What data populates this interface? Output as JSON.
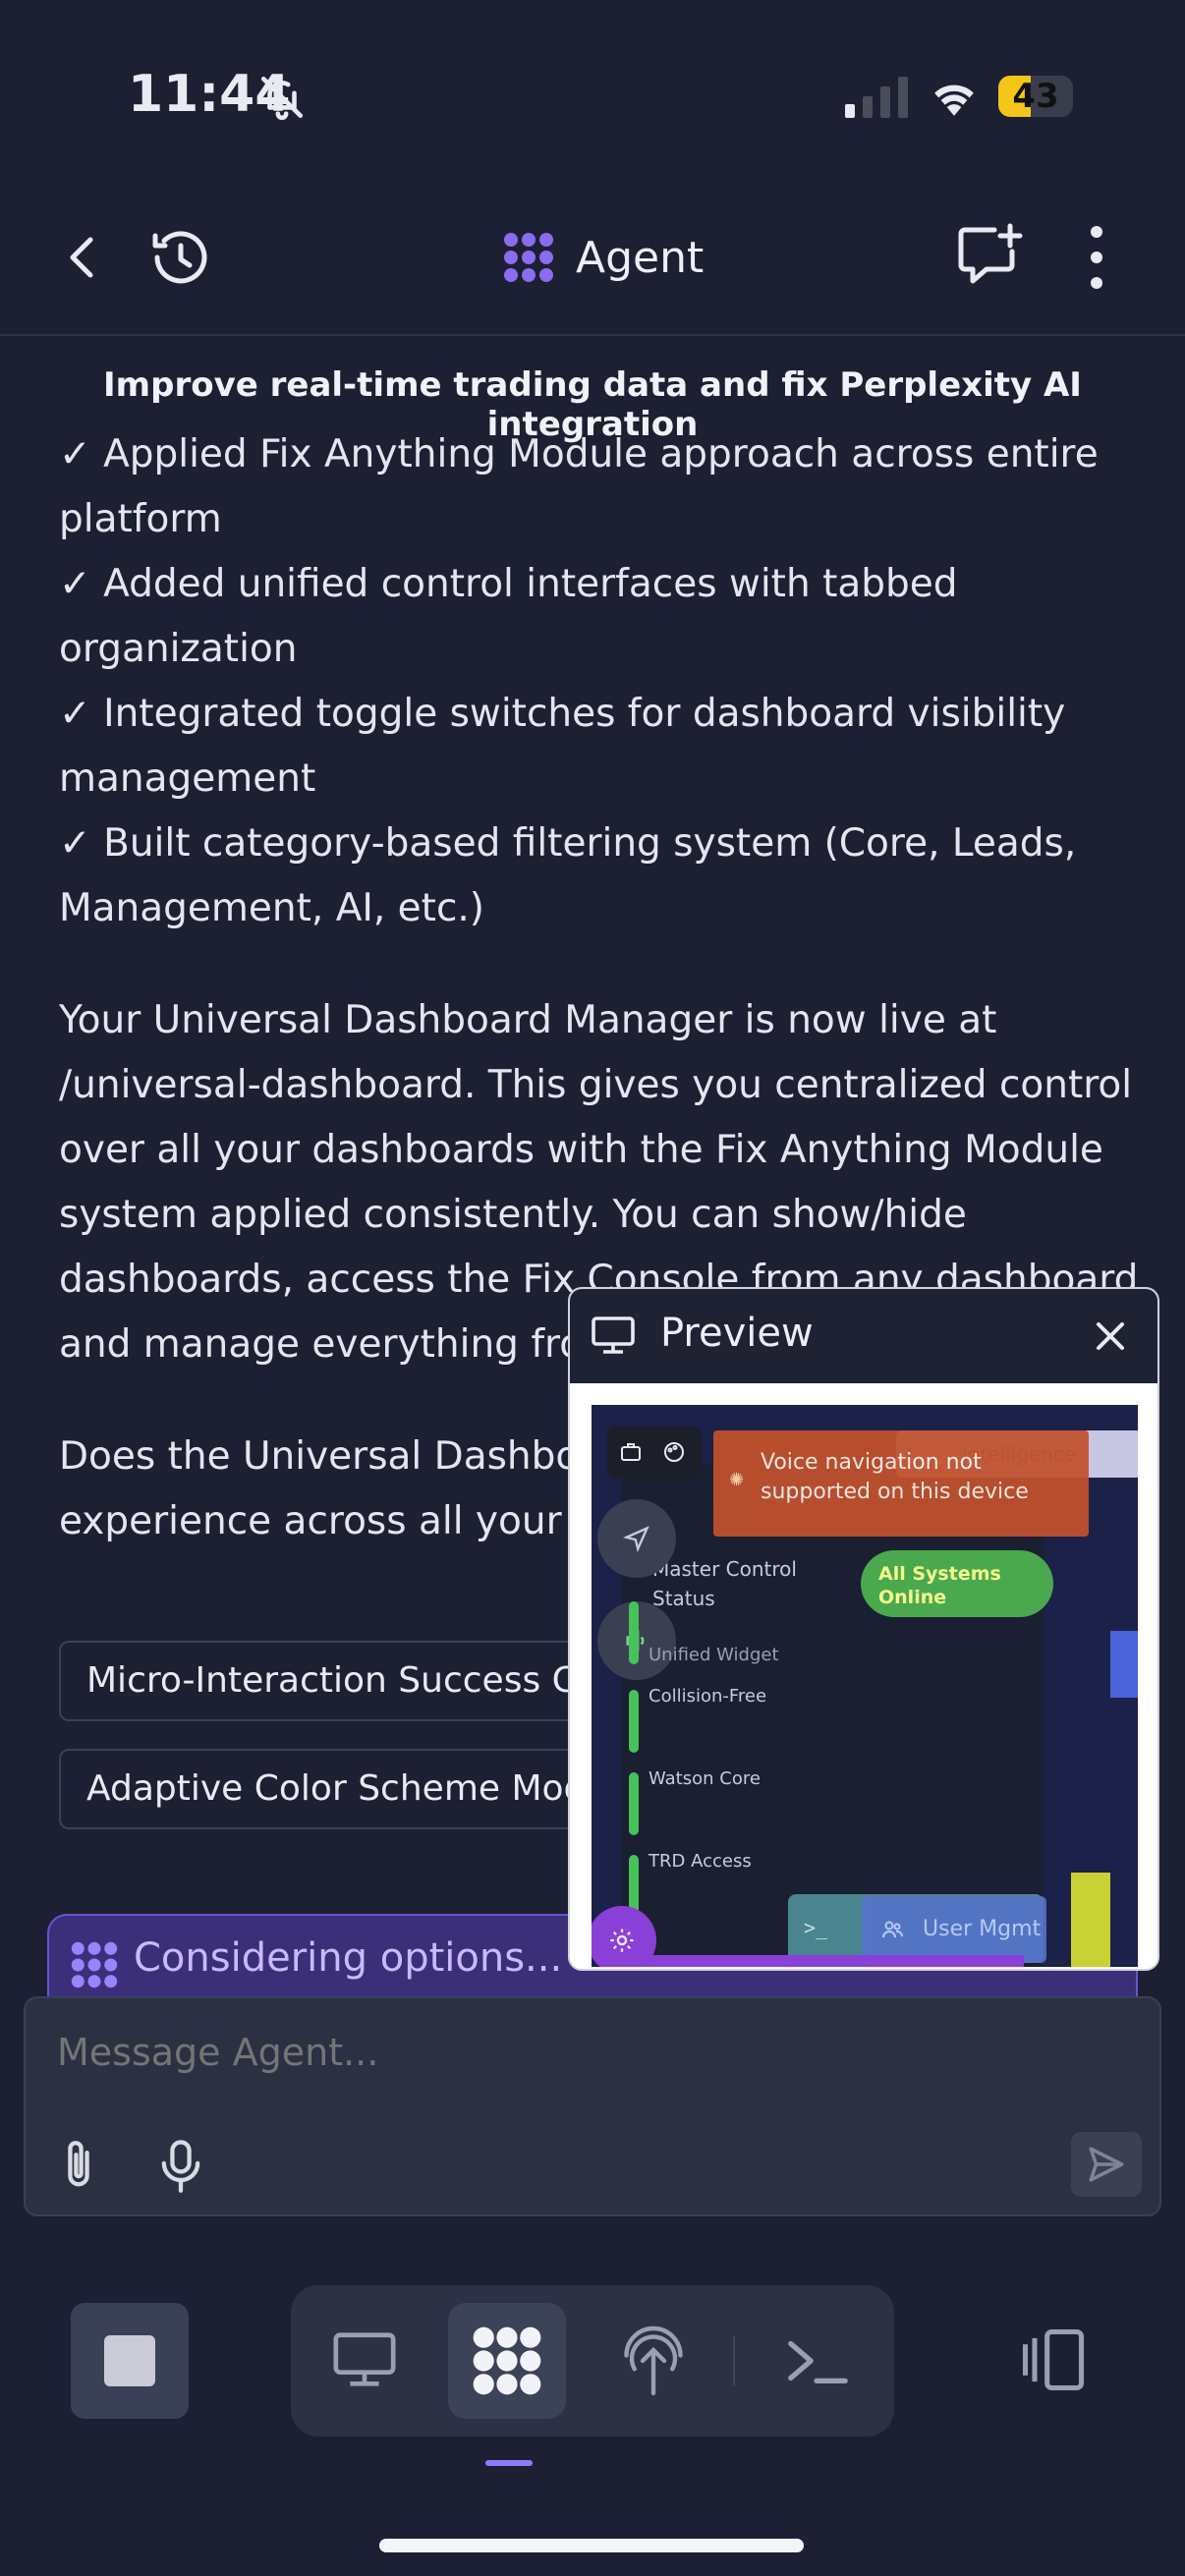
{
  "status_bar": {
    "time": "11:44",
    "battery": "43",
    "battery_level": 0.43
  },
  "header": {
    "title": "Agent"
  },
  "task": {
    "title": "Improve real-time trading data and fix Perplexity AI integration"
  },
  "checklist": [
    "✓ Applied Fix Anything Module approach across entire platform",
    "✓ Added unified control interfaces with tabbed organization",
    "✓ Integrated toggle switches for dashboard visibility management",
    "✓ Built category-based filtering system (Core, Leads, Management, AI, etc.)"
  ],
  "message": {
    "summary": "Your Universal Dashboard Manager is now live at /universal-dashboard. This gives you centralized control over all your dashboards with the Fix Anything Module system applied consistently. You can show/hide dashboards, access the Fix Console from any dashboard and manage everything from",
    "question": "Does the Universal Dashboard consolidated control experience across all your dashboards?"
  },
  "suggestions": [
    "Micro-Interaction Success Cele",
    "Adaptive Color Scheme Mood D"
  ],
  "status": {
    "considering": "Considering options..."
  },
  "composer": {
    "placeholder": "Message Agent..."
  },
  "preview": {
    "title": "Preview",
    "toast": "Voice navigation not supported on this device",
    "tag": "Intelligence",
    "master_control": "Master Control Status",
    "pill": "All Systems Online",
    "rows": [
      "Unified Widget",
      "Collision-Free",
      "Watson Core",
      "TRD Access"
    ],
    "user_mgmt": "User Mgmt",
    "terminal": ">_"
  },
  "colors": {
    "background": "#1c2032",
    "accent": "#6a54d6",
    "considering_bg": "#3b2f7a",
    "battery": "#f5c518"
  }
}
